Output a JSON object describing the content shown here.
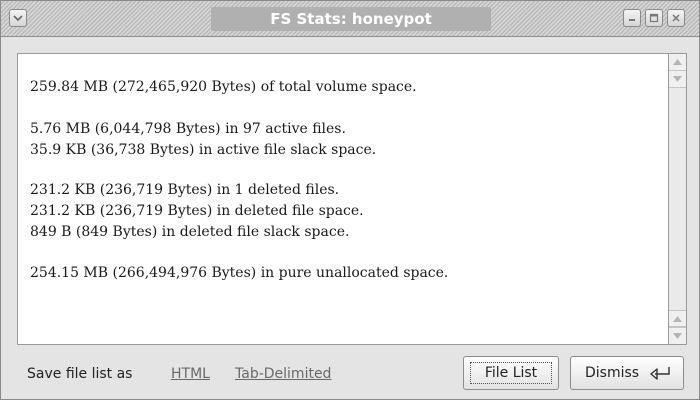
{
  "window": {
    "title": "FS Stats: honeypot"
  },
  "stats": {
    "lines": [
      "259.84 MB (272,465,920 Bytes) of total volume space.",
      "5.76 MB (6,044,798 Bytes) in 97 active files.",
      "35.9 KB (36,738 Bytes) in active file slack space.",
      "231.2 KB (236,719 Bytes) in 1 deleted files.",
      "231.2 KB (236,719 Bytes) in deleted file space.",
      "849 B (849 Bytes) in deleted file slack space.",
      "254.15 MB (266,494,976 Bytes) in pure unallocated space."
    ]
  },
  "footer": {
    "save_label": "Save file list as",
    "html_link": "HTML",
    "tab_link": "Tab-Delimited",
    "file_list_button": "File List",
    "dismiss_button": "Dismiss"
  },
  "icons": {
    "menu": "chevron-down-icon",
    "minimize": "minimize-icon",
    "maximize": "maximize-icon",
    "close": "close-icon",
    "enter": "enter-key-icon"
  }
}
